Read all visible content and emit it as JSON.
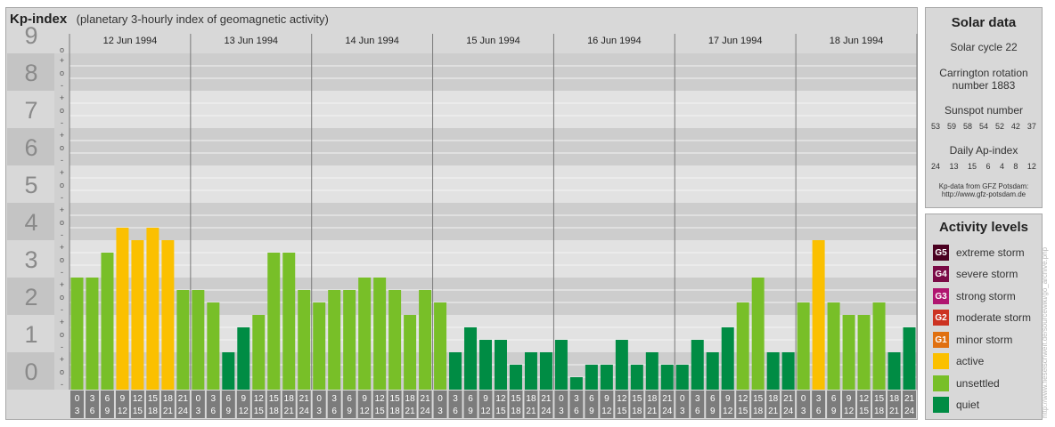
{
  "header": {
    "title": "Kp-index",
    "subtitle": "(planetary 3-hourly index of geomagnetic activity)"
  },
  "solar_data": {
    "title": "Solar data",
    "solar_cycle": "Solar cycle 22",
    "carrington_line1": "Carrington rotation",
    "carrington_line2": "number 1883",
    "sunspot_title": "Sunspot number",
    "sunspot_values": [
      "53",
      "59",
      "58",
      "54",
      "52",
      "42",
      "37"
    ],
    "ap_title": "Daily Ap-index",
    "ap_values": [
      "24",
      "13",
      "15",
      "6",
      "4",
      "8",
      "12"
    ],
    "credit_line1": "Kp-data from GFZ Potsdam:",
    "credit_line2": "http://www.gfz-potsdam.de"
  },
  "activity_levels": {
    "title": "Activity levels",
    "items": [
      {
        "badge": "G5",
        "label": "extreme storm",
        "color": "#4a0020"
      },
      {
        "badge": "G4",
        "label": "severe storm",
        "color": "#7a0a46"
      },
      {
        "badge": "G3",
        "label": "strong storm",
        "color": "#b01570"
      },
      {
        "badge": "G2",
        "label": "moderate storm",
        "color": "#cc3322"
      },
      {
        "badge": "G1",
        "label": "minor storm",
        "color": "#e07010"
      },
      {
        "badge": "",
        "label": "active",
        "color": "#fbc000"
      },
      {
        "badge": "",
        "label": "unsettled",
        "color": "#78bf28"
      },
      {
        "badge": "",
        "label": "quiet",
        "color": "#008c44"
      }
    ]
  },
  "watermark": "http://www.fieselschweif.de/sourcewiki/go_archive.php",
  "chart_data": {
    "type": "bar",
    "ylim": [
      0,
      9
    ],
    "y_ticks": [
      "0",
      "1",
      "2",
      "3",
      "4",
      "5",
      "6",
      "7",
      "8",
      "9"
    ],
    "days": [
      "12 Jun 1994",
      "13 Jun 1994",
      "14 Jun 1994",
      "15 Jun 1994",
      "16 Jun 1994",
      "17 Jun 1994",
      "18 Jun 1994"
    ],
    "interval_start": [
      "0",
      "3",
      "6",
      "9",
      "12",
      "15",
      "18",
      "21"
    ],
    "interval_end": [
      "3",
      "6",
      "9",
      "12",
      "15",
      "18",
      "21",
      "24"
    ],
    "values": [
      3.0,
      3.0,
      3.667,
      4.333,
      4.0,
      4.333,
      4.0,
      2.667,
      2.667,
      2.333,
      1.0,
      1.667,
      2.0,
      3.667,
      3.667,
      2.667,
      2.333,
      2.667,
      2.667,
      3.0,
      3.0,
      2.667,
      2.0,
      2.667,
      2.333,
      1.0,
      1.667,
      1.333,
      1.333,
      0.667,
      1.0,
      1.0,
      1.333,
      0.333,
      0.667,
      0.667,
      1.333,
      0.667,
      1.0,
      0.667,
      0.667,
      1.333,
      1.0,
      1.667,
      2.333,
      3.0,
      1.0,
      1.0,
      2.333,
      4.0,
      2.333,
      2.0,
      2.0,
      2.333,
      1.0,
      1.667
    ],
    "colors": {
      "quiet": "#008c44",
      "unsettled": "#78bf28",
      "active": "#fbc000"
    }
  }
}
